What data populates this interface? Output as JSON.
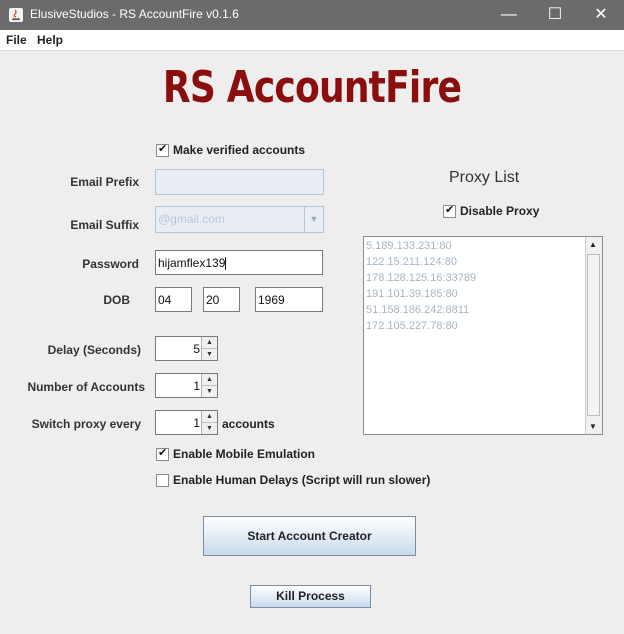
{
  "window": {
    "title": "ElusiveStudios - RS AccountFire v0.1.6",
    "controls": {
      "minimize": "—",
      "maximize": "☐",
      "close": "✕"
    }
  },
  "menu": {
    "file": "File",
    "help": "Help"
  },
  "headline": "RS AccountFire",
  "form": {
    "make_verified": {
      "label": "Make verified accounts",
      "checked": true
    },
    "email_prefix": {
      "label": "Email Prefix",
      "value": ""
    },
    "email_suffix": {
      "label": "Email Suffix",
      "value": "@gmail.com"
    },
    "password": {
      "label": "Password",
      "value": "hijamflex139"
    },
    "dob": {
      "label": "DOB",
      "month": "04",
      "day": "20",
      "year": "1969"
    },
    "delay": {
      "label": "Delay (Seconds)",
      "value": "5"
    },
    "num_accounts": {
      "label": "Number of Accounts",
      "value": "1"
    },
    "switch_proxy": {
      "label": "Switch proxy every",
      "value": "1",
      "suffix": "accounts"
    },
    "mobile_emulation": {
      "label": "Enable Mobile Emulation",
      "checked": true
    },
    "human_delays": {
      "label": "Enable Human Delays (Script will run slower)",
      "checked": false
    }
  },
  "proxy": {
    "title": "Proxy List",
    "disable_proxy": {
      "label": "Disable Proxy",
      "checked": true
    },
    "list": [
      "5.189.133.231:80",
      "122.15.211.124:80",
      "178.128.125.16:33789",
      "191.101.39.185:80",
      "51.158.186.242:8811",
      "172.105.227.78:80"
    ]
  },
  "buttons": {
    "start": "Start Account Creator",
    "kill": "Kill Process"
  },
  "colors": {
    "headline": "#8b0e0e",
    "titlebar": "#6b6b6b",
    "disabled_text": "#a7b5c4"
  }
}
